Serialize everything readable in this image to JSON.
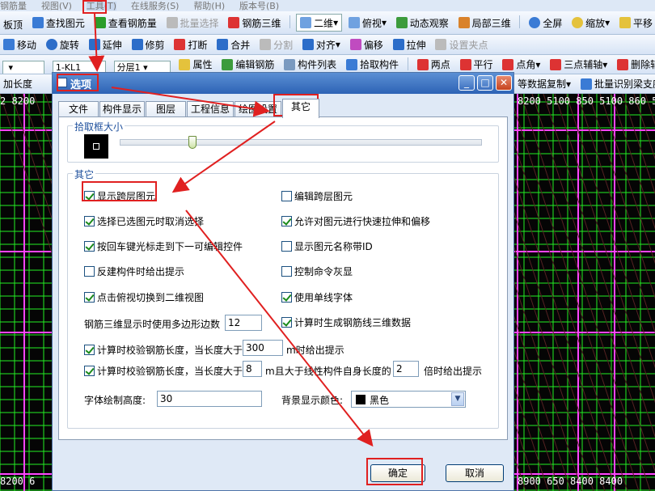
{
  "app": {
    "menu": [
      "钢筋量",
      "视图(V)",
      "工具(T)",
      "在线服务(S)",
      "帮助(H)",
      "版本号(B)"
    ],
    "toolbar1": [
      "板顶",
      "查找图元",
      "查看钢筋量",
      "批量选择",
      "钢筋三维",
      "二维",
      "俯视",
      "动态观察",
      "局部三维",
      "全屏",
      "缩放",
      "平移"
    ],
    "toolbar2": [
      "移动",
      "旋转",
      "延伸",
      "修剪",
      "打断",
      "合并",
      "分割",
      "对齐",
      "偏移",
      "拉伸",
      "设置夹点"
    ],
    "toolbar3": {
      "component": "1-KL1",
      "layer": "分层1",
      "items": [
        "属性",
        "编辑钢筋",
        "构件列表",
        "拾取构件",
        "两点",
        "平行",
        "点角",
        "三点辅轴",
        "删除辅轴"
      ]
    },
    "toolbar4": {
      "left": "加长度",
      "right": [
        "等数据复制",
        "批量识别梁支座"
      ]
    },
    "cad_labels": {
      "left_top": "2 8200",
      "right_top": "8200 5100 850 5100 860 5",
      "left_bottom": "8200 6",
      "right_bottom": "8900 650 8400 8400"
    }
  },
  "dialog": {
    "title": "选项",
    "tabs": [
      "文件",
      "构件显示",
      "图层",
      "工程信息",
      "绘图设置",
      "其它"
    ],
    "active_tab": "其它",
    "pick_group": {
      "label": "拾取框大小",
      "slider_fraction": 0.2
    },
    "other_group": {
      "label": "其它",
      "left": [
        {
          "label": "显示跨层图元",
          "checked": true
        },
        {
          "label": "选择已选图元时取消选择",
          "checked": true
        },
        {
          "label": "按回车键光标走到下一可编辑控件",
          "checked": true
        },
        {
          "label": "反建构件时给出提示",
          "checked": false
        },
        {
          "label": "点击俯视切换到二维视图",
          "checked": true
        }
      ],
      "right": [
        {
          "label": "编辑跨层图元",
          "checked": false
        },
        {
          "label": "允许对图元进行快速拉伸和偏移",
          "checked": true
        },
        {
          "label": "显示图元名称带ID",
          "checked": false
        },
        {
          "label": "控制命令灰显",
          "checked": false
        },
        {
          "label": "使用单线字体",
          "checked": true
        },
        {
          "label": "计算时生成钢筋线三维数据",
          "checked": true
        }
      ],
      "polygon_label": "钢筋三维显示时使用多边形边数",
      "polygon_value": "12",
      "check_len1": {
        "label": "计算时校验钢筋长度，当长度大于",
        "value": "300",
        "suffix": "m时给出提示",
        "checked": true
      },
      "check_len2": {
        "label": "计算时校验钢筋长度，当长度大于",
        "value": "8",
        "suffix": "m且大于线性构件自身长度的",
        "value2": "2",
        "suffix2": "倍时给出提示",
        "checked": true
      },
      "font_height_label": "字体绘制高度:",
      "font_height_value": "30",
      "bg_color_label": "背景显示颜色:",
      "bg_color_value": "黑色"
    },
    "ok_label": "确定",
    "cancel_label": "取消"
  },
  "colors": {
    "annotation": "#e02020",
    "title_bar": "#2d63b5",
    "cad_grid": "#22ee22",
    "cad_beam": "#ff44ff"
  }
}
